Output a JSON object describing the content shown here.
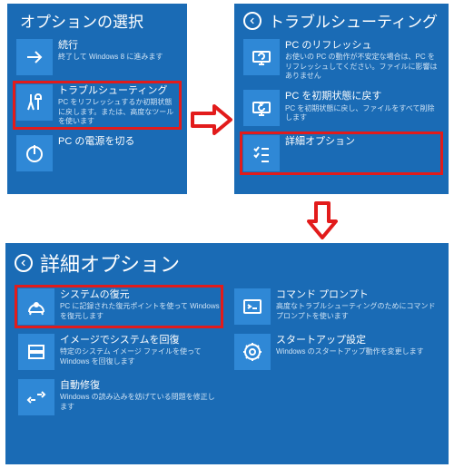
{
  "screens": {
    "chooseOption": {
      "title": "オプションの選択",
      "hasBack": false,
      "tiles": [
        {
          "icon": "arrow-right-icon",
          "title": "続行",
          "desc": "終了して Windows 8 に進みます",
          "highlighted": false
        },
        {
          "icon": "tools-icon",
          "title": "トラブルシューティング",
          "desc": "PC をリフレッシュするか初期状態に戻します。または、高度なツールを使います",
          "highlighted": true
        },
        {
          "icon": "power-icon",
          "title": "PC の電源を切る",
          "desc": "",
          "highlighted": false
        }
      ]
    },
    "troubleshoot": {
      "title": "トラブルシューティング",
      "hasBack": true,
      "tiles": [
        {
          "icon": "refresh-pc-icon",
          "title": "PC のリフレッシュ",
          "desc": "お使いの PC の動作が不安定な場合は、PC をリフレッシュしてください。ファイルに影響はありません",
          "highlighted": false
        },
        {
          "icon": "reset-pc-icon",
          "title": "PC を初期状態に戻す",
          "desc": "PC を初期状態に戻し、ファイルをすべて削除します",
          "highlighted": false
        },
        {
          "icon": "checklist-icon",
          "title": "詳細オプション",
          "desc": "",
          "highlighted": true
        }
      ]
    },
    "advanced": {
      "title": "詳細オプション",
      "hasBack": true,
      "tiles": [
        {
          "icon": "restore-icon",
          "title": "システムの復元",
          "desc": "PC に記録された復元ポイントを使って Windows を復元します",
          "highlighted": true
        },
        {
          "icon": "cmd-icon",
          "title": "コマンド プロンプト",
          "desc": "高度なトラブルシューティングのためにコマンド プロンプトを使います",
          "highlighted": false
        },
        {
          "icon": "image-recover-icon",
          "title": "イメージでシステムを回復",
          "desc": "特定のシステム イメージ ファイルを使って Windows を回復します",
          "highlighted": false
        },
        {
          "icon": "startup-icon",
          "title": "スタートアップ設定",
          "desc": "Windows のスタートアップ動作を変更します",
          "highlighted": false
        },
        {
          "icon": "auto-repair-icon",
          "title": "自動修復",
          "desc": "Windows の読み込みを妨げている問題を修正します",
          "highlighted": false
        }
      ]
    }
  }
}
